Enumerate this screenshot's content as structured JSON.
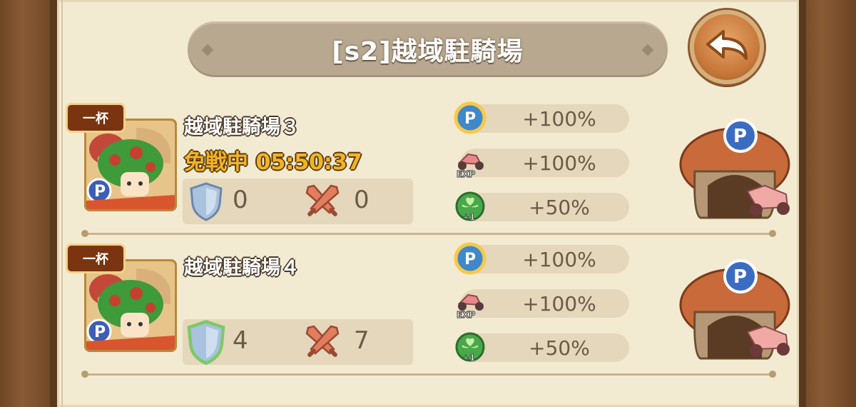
{
  "title": "[s2]越域駐騎場",
  "rows": [
    {
      "badge": "一杯",
      "name": "越域駐騎場３",
      "timer": "免戦中 05:50:37",
      "defense": "0",
      "attack": "0",
      "bonuses": [
        {
          "icon": "p-coin-icon",
          "value": "+100%"
        },
        {
          "icon": "exp-scooter-icon",
          "value": "+100%"
        },
        {
          "icon": "clover-plus-one-icon",
          "value": "+50%"
        }
      ]
    },
    {
      "badge": "一杯",
      "name": "越域駐騎場４",
      "timer": "",
      "defense": "4",
      "attack": "7",
      "bonuses": [
        {
          "icon": "p-coin-icon",
          "value": "+100%"
        },
        {
          "icon": "exp-scooter-icon",
          "value": "+100%"
        },
        {
          "icon": "clover-plus-one-icon",
          "value": "+50%"
        }
      ]
    }
  ],
  "colors": {
    "panel": "#f3ead2",
    "frame": "#7a5232",
    "timer": "#f0b42a",
    "badge": "#7a3510"
  }
}
